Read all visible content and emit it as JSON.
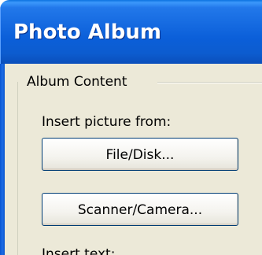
{
  "window": {
    "title": "Photo Album"
  },
  "album_content": {
    "group_label": "Album Content",
    "insert_picture_label": "Insert picture from:",
    "file_disk_button": "File/Disk...",
    "scanner_camera_button": "Scanner/Camera...",
    "insert_text_label": "Insert text:"
  },
  "colors": {
    "titlebar_blue": "#0b5fd9",
    "dialog_background": "#ece9d8",
    "button_border": "#003c74"
  }
}
